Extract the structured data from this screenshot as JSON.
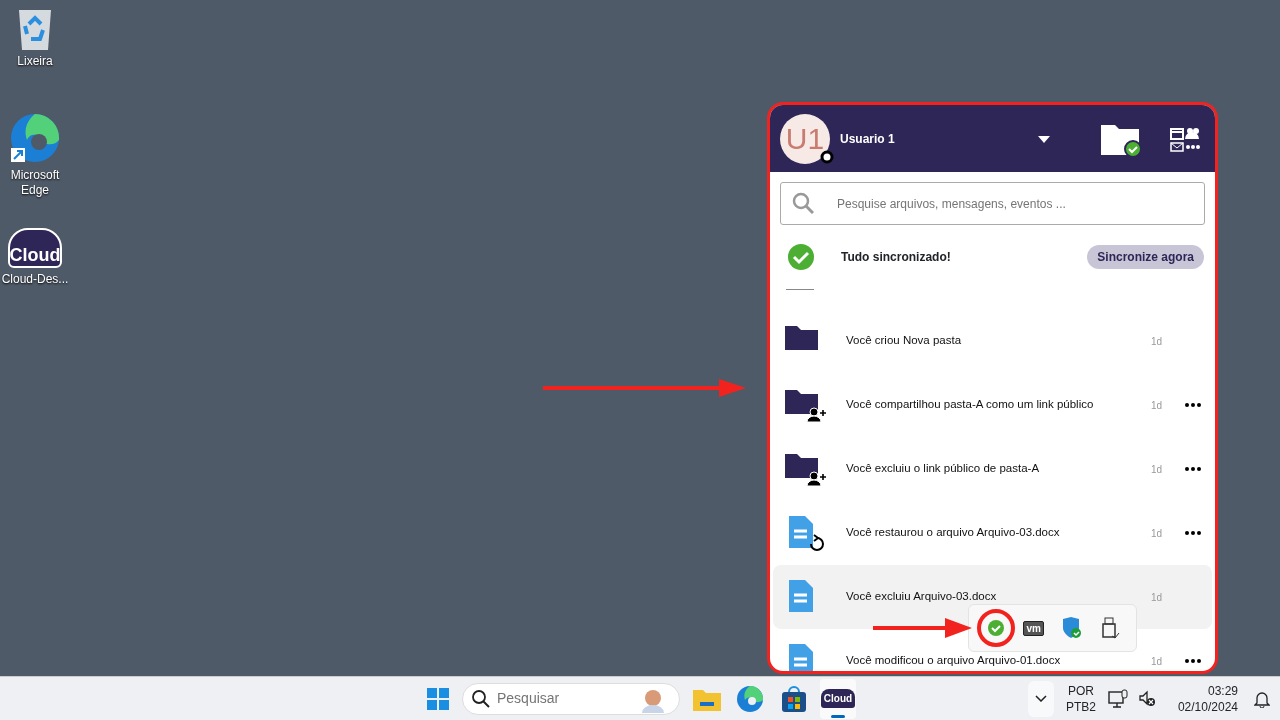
{
  "desktop_icons": [
    {
      "kind": "recycle",
      "label": "Lixeira"
    },
    {
      "kind": "edge",
      "label": "Microsoft Edge"
    },
    {
      "kind": "cloud",
      "label": "Cloud-Des...",
      "logo_text": "Cloud"
    }
  ],
  "panel": {
    "user": {
      "initials": "U1",
      "name": "Usuario 1"
    },
    "search": {
      "placeholder": "Pesquise arquivos, mensagens, eventos ..."
    },
    "sync": {
      "status": "Tudo sincronizado!",
      "button": "Sincronize agora"
    },
    "activities": [
      {
        "kind": "folder",
        "text": "Você criou Nova pasta",
        "time": "1d",
        "menu": false,
        "highlighted": false
      },
      {
        "kind": "folder-share",
        "text": "Você compartilhou pasta-A como um link público",
        "time": "1d",
        "menu": true,
        "highlighted": false
      },
      {
        "kind": "folder-share",
        "text": "Você excluiu o link público de pasta-A",
        "time": "1d",
        "menu": true,
        "highlighted": false
      },
      {
        "kind": "file-restore",
        "text": "Você restaurou o arquivo Arquivo-03.docx",
        "time": "1d",
        "menu": true,
        "highlighted": false
      },
      {
        "kind": "file",
        "text": "Você excluiu Arquivo-03.docx",
        "time": "1d",
        "menu": false,
        "highlighted": true
      },
      {
        "kind": "file",
        "text": "Você modificou o arquivo Arquivo-01.docx",
        "time": "1d",
        "menu": true,
        "highlighted": false
      }
    ]
  },
  "tray_popup": [
    {
      "kind": "sync-check",
      "circled": true
    },
    {
      "kind": "vm",
      "label": "vm",
      "circled": false
    },
    {
      "kind": "shield",
      "circled": false
    },
    {
      "kind": "usb",
      "circled": false
    }
  ],
  "taskbar": {
    "search_placeholder": "Pesquisar",
    "apps": [
      {
        "kind": "explorer",
        "active": false
      },
      {
        "kind": "edge",
        "active": false
      },
      {
        "kind": "store",
        "active": false
      },
      {
        "kind": "cloud",
        "logo_text": "Cloud",
        "active": true
      }
    ],
    "language": [
      "POR",
      "PTB2"
    ],
    "time": "03:29",
    "date": "02/10/2024"
  }
}
